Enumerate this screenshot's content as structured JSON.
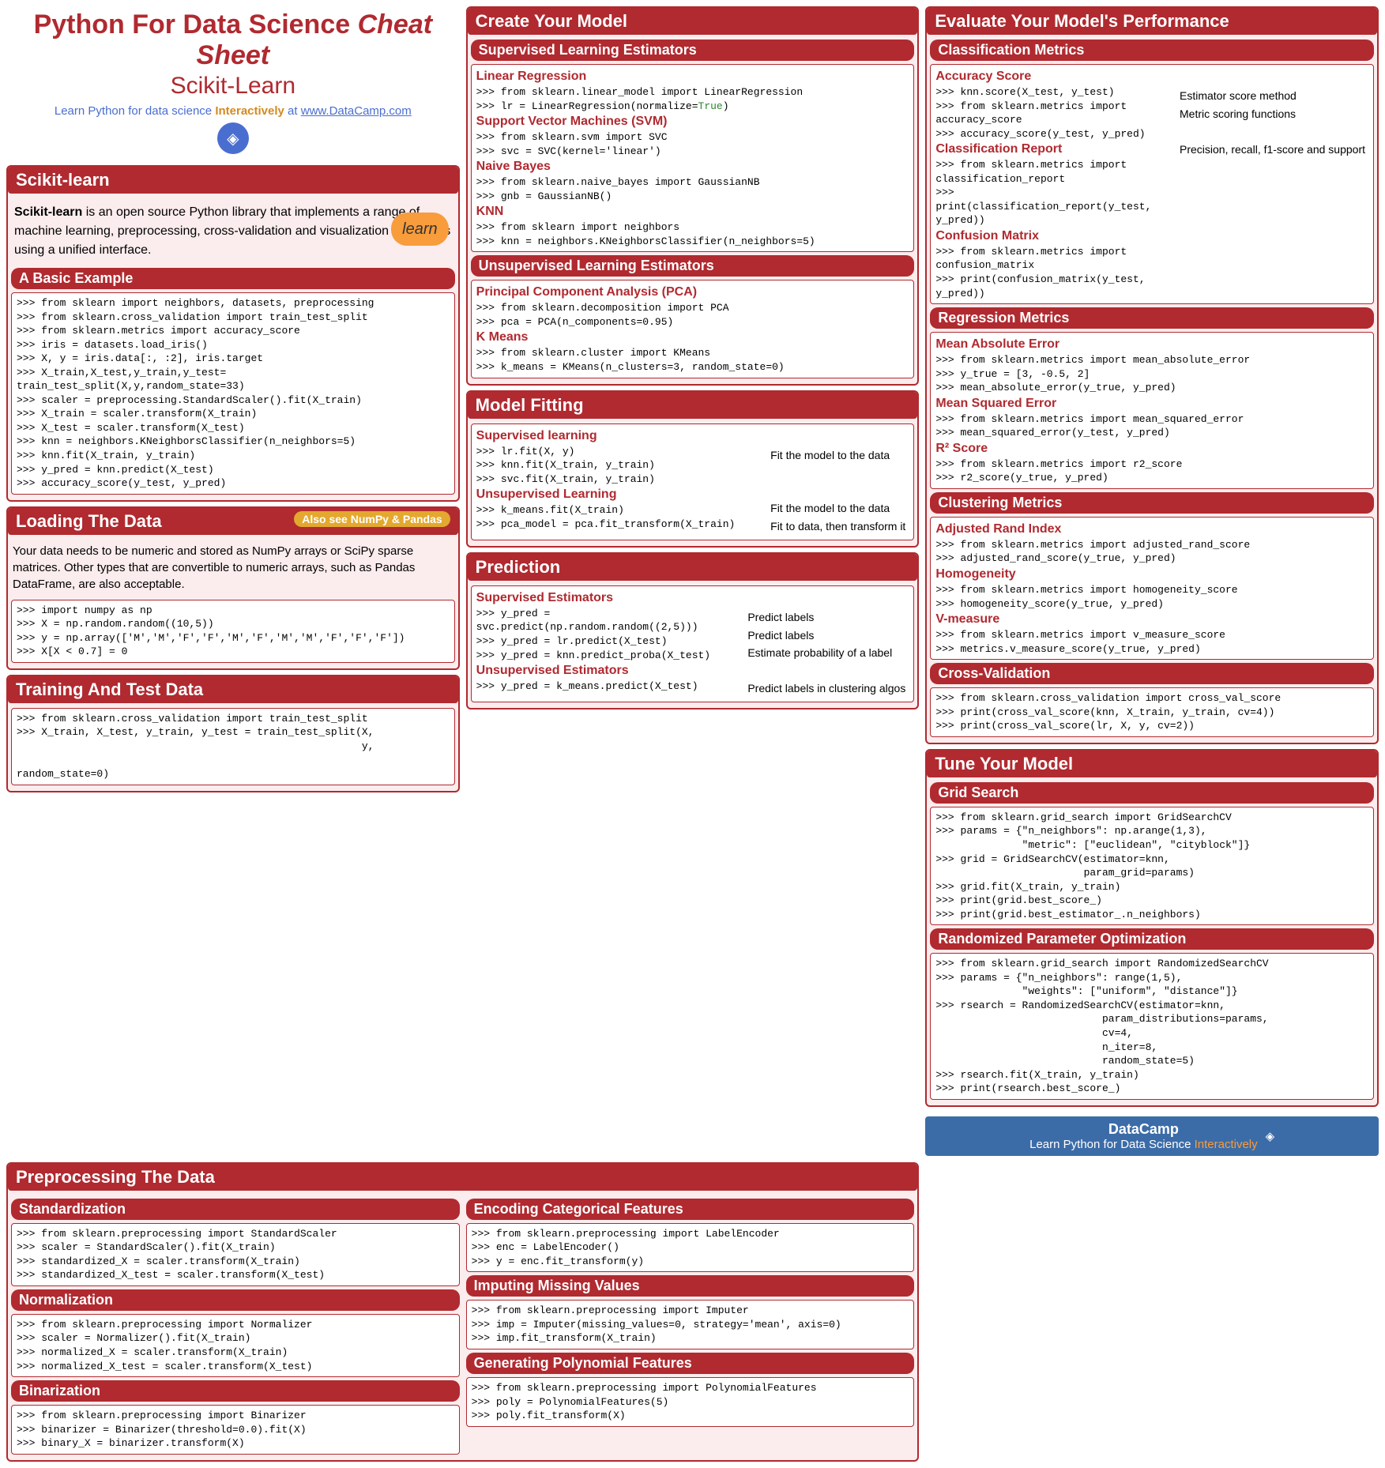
{
  "header": {
    "title_a": "Python For Data Science",
    "title_b": "Cheat Sheet",
    "subtitle": "Scikit-Learn",
    "tagline_a": "Learn Python for data science",
    "tagline_b": "Interactively",
    "tagline_c": "at",
    "link": "www.DataCamp.com"
  },
  "sklearn_intro": {
    "title": "Scikit-learn",
    "text_a": "Scikit-learn",
    "text_b": " is an open source Python library that implements a range of machine learning, preprocessing, cross-validation and visualization algorithms using a unified interface.",
    "logo": "learn"
  },
  "basic_example": {
    "title": "A Basic Example",
    "code": ">>> from sklearn import neighbors, datasets, preprocessing\n>>> from sklearn.cross_validation import train_test_split\n>>> from sklearn.metrics import accuracy_score\n>>> iris = datasets.load_iris()\n>>> X, y = iris.data[:, :2], iris.target\n>>> X_train,X_test,y_train,y_test= train_test_split(X,y,random_state=33)\n>>> scaler = preprocessing.StandardScaler().fit(X_train)\n>>> X_train = scaler.transform(X_train)\n>>> X_test = scaler.transform(X_test)\n>>> knn = neighbors.KNeighborsClassifier(n_neighbors=5)\n>>> knn.fit(X_train, y_train)\n>>> y_pred = knn.predict(X_test)\n>>> accuracy_score(y_test, y_pred)"
  },
  "loading": {
    "title": "Loading The Data",
    "also": "Also see NumPy & Pandas",
    "para": "Your data needs to be numeric and stored as NumPy arrays or SciPy sparse matrices. Other types that are convertible to numeric arrays, such as Pandas DataFrame, are also acceptable.",
    "code": ">>> import numpy as np\n>>> X = np.random.random((10,5))\n>>> y = np.array(['M','M','F','F','M','F','M','M','F','F','F'])\n>>> X[X < 0.7] = 0"
  },
  "training": {
    "title": "Training And Test Data",
    "code": ">>> from sklearn.cross_validation import train_test_split\n>>> X_train, X_test, y_train, y_test = train_test_split(X,\n                                                        y,\n                                                        random_state=0)"
  },
  "preprocessing": {
    "title": "Preprocessing The Data",
    "standardization": {
      "title": "Standardization",
      "code": ">>> from sklearn.preprocessing import StandardScaler\n>>> scaler = StandardScaler().fit(X_train)\n>>> standardized_X = scaler.transform(X_train)\n>>> standardized_X_test = scaler.transform(X_test)"
    },
    "normalization": {
      "title": "Normalization",
      "code": ">>> from sklearn.preprocessing import Normalizer\n>>> scaler = Normalizer().fit(X_train)\n>>> normalized_X = scaler.transform(X_train)\n>>> normalized_X_test = scaler.transform(X_test)"
    },
    "binarization": {
      "title": "Binarization",
      "code": ">>> from sklearn.preprocessing import Binarizer\n>>> binarizer = Binarizer(threshold=0.0).fit(X)\n>>> binary_X = binarizer.transform(X)"
    },
    "encoding": {
      "title": "Encoding Categorical Features",
      "code": ">>> from sklearn.preprocessing import LabelEncoder\n>>> enc = LabelEncoder()\n>>> y = enc.fit_transform(y)"
    },
    "imputing": {
      "title": "Imputing Missing Values",
      "code": ">>> from sklearn.preprocessing import Imputer\n>>> imp = Imputer(missing_values=0, strategy='mean', axis=0)\n>>> imp.fit_transform(X_train)"
    },
    "polynomial": {
      "title": "Generating Polynomial Features",
      "code": ">>> from sklearn.preprocessing import PolynomialFeatures\n>>> poly = PolynomialFeatures(5)\n>>> poly.fit_transform(X)"
    }
  },
  "create_model": {
    "title": "Create Your Model",
    "supervised": {
      "title": "Supervised Learning Estimators",
      "linreg": {
        "title": "Linear Regression",
        "code1": ">>> from sklearn.linear_model import LinearRegression",
        "code2a": ">>> lr = LinearRegression(normalize=",
        "code2b": "True",
        "code2c": ")"
      },
      "svm": {
        "title": "Support Vector Machines (SVM)",
        "code": ">>> from sklearn.svm import SVC\n>>> svc = SVC(kernel='linear')"
      },
      "nb": {
        "title": "Naive Bayes",
        "code": ">>> from sklearn.naive_bayes import GaussianNB\n>>> gnb = GaussianNB()"
      },
      "knn": {
        "title": "KNN",
        "code": ">>> from sklearn import neighbors\n>>> knn = neighbors.KNeighborsClassifier(n_neighbors=5)"
      }
    },
    "unsupervised": {
      "title": "Unsupervised Learning Estimators",
      "pca": {
        "title": "Principal Component Analysis (PCA)",
        "code": ">>> from sklearn.decomposition import PCA\n>>> pca = PCA(n_components=0.95)"
      },
      "kmeans": {
        "title": "K Means",
        "code": ">>> from sklearn.cluster import KMeans\n>>> k_means = KMeans(n_clusters=3, random_state=0)"
      }
    }
  },
  "fitting": {
    "title": "Model Fitting",
    "sup": {
      "title": "Supervised learning",
      "code": ">>> lr.fit(X, y)\n>>> knn.fit(X_train, y_train)\n>>> svc.fit(X_train, y_train)",
      "note": "Fit the model to the data"
    },
    "unsup": {
      "title": "Unsupervised Learning",
      "code": ">>> k_means.fit(X_train)\n>>> pca_model = pca.fit_transform(X_train)",
      "note1": "Fit the model to the data",
      "note2": "Fit to data, then transform it"
    }
  },
  "prediction": {
    "title": "Prediction",
    "sup": {
      "title": "Supervised Estimators",
      "code": ">>> y_pred = svc.predict(np.random.random((2,5)))\n>>> y_pred = lr.predict(X_test)\n>>> y_pred = knn.predict_proba(X_test)",
      "note1": "Predict labels",
      "note2": "Predict labels",
      "note3": "Estimate probability of a label"
    },
    "unsup": {
      "title": "Unsupervised Estimators",
      "code": ">>> y_pred = k_means.predict(X_test)",
      "note": "Predict labels in clustering algos"
    }
  },
  "evaluate": {
    "title": "Evaluate Your Model's Performance",
    "classification": {
      "title": "Classification Metrics",
      "accuracy": {
        "title": "Accuracy Score",
        "code": ">>> knn.score(X_test, y_test)\n>>> from sklearn.metrics import accuracy_score\n>>> accuracy_score(y_test, y_pred)",
        "note1": "Estimator score method",
        "note2": "Metric scoring functions"
      },
      "report": {
        "title": "Classification Report",
        "code": ">>> from sklearn.metrics import classification_report\n>>> print(classification_report(y_test, y_pred))",
        "note": "Precision, recall, f1-score and support"
      },
      "confusion": {
        "title": "Confusion Matrix",
        "code": ">>> from sklearn.metrics import confusion_matrix\n>>> print(confusion_matrix(y_test, y_pred))"
      }
    },
    "regression": {
      "title": "Regression Metrics",
      "mae": {
        "title": "Mean Absolute Error",
        "code": ">>> from sklearn.metrics import mean_absolute_error\n>>> y_true = [3, -0.5, 2]\n>>> mean_absolute_error(y_true, y_pred)"
      },
      "mse": {
        "title": "Mean Squared Error",
        "code": ">>> from sklearn.metrics import mean_squared_error\n>>> mean_squared_error(y_test, y_pred)"
      },
      "r2": {
        "title": "R² Score",
        "code": ">>> from sklearn.metrics import r2_score\n>>> r2_score(y_true, y_pred)"
      }
    },
    "clustering": {
      "title": "Clustering Metrics",
      "ari": {
        "title": "Adjusted Rand Index",
        "code": ">>> from sklearn.metrics import adjusted_rand_score\n>>> adjusted_rand_score(y_true, y_pred)"
      },
      "homo": {
        "title": "Homogeneity",
        "code": ">>> from sklearn.metrics import homogeneity_score\n>>> homogeneity_score(y_true, y_pred)"
      },
      "vmeasure": {
        "title": "V-measure",
        "code": ">>> from sklearn.metrics import v_measure_score\n>>> metrics.v_measure_score(y_true, y_pred)"
      }
    },
    "crossval": {
      "title": "Cross-Validation",
      "code": ">>> from sklearn.cross_validation import cross_val_score\n>>> print(cross_val_score(knn, X_train, y_train, cv=4))\n>>> print(cross_val_score(lr, X, y, cv=2))"
    }
  },
  "tune": {
    "title": "Tune Your Model",
    "grid": {
      "title": "Grid Search",
      "code": ">>> from sklearn.grid_search import GridSearchCV\n>>> params = {\"n_neighbors\": np.arange(1,3),\n              \"metric\": [\"euclidean\", \"cityblock\"]}\n>>> grid = GridSearchCV(estimator=knn,\n                        param_grid=params)\n>>> grid.fit(X_train, y_train)\n>>> print(grid.best_score_)\n>>> print(grid.best_estimator_.n_neighbors)"
    },
    "random": {
      "title": "Randomized Parameter Optimization",
      "code": ">>> from sklearn.grid_search import RandomizedSearchCV\n>>> params = {\"n_neighbors\": range(1,5),\n              \"weights\": [\"uniform\", \"distance\"]}\n>>> rsearch = RandomizedSearchCV(estimator=knn,\n                           param_distributions=params,\n                           cv=4,\n                           n_iter=8,\n                           random_state=5)\n>>> rsearch.fit(X_train, y_train)\n>>> print(rsearch.best_score_)"
    }
  },
  "footer": {
    "brand": "DataCamp",
    "line_a": "Learn Python for Data Science",
    "line_b": "Interactively"
  }
}
